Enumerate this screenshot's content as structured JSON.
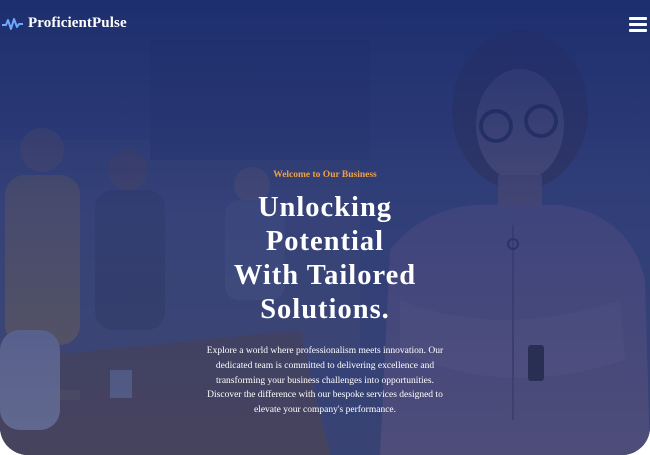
{
  "brand": {
    "name": "ProficientPulse",
    "icon": "pulse-icon"
  },
  "nav": {
    "menu_icon": "hamburger-menu-icon"
  },
  "hero": {
    "eyebrow": "Welcome to Our Business",
    "headline_lines": [
      "Unlocking",
      "Potential",
      "With Tailored",
      "Solutions."
    ],
    "description": "Explore a world where professionalism meets innovation. Our dedicated team is committed to delivering excellence and transforming your business challenges into opportunities. Discover the difference with our bespoke services designed to elevate your company's performance."
  },
  "colors": {
    "overlay": "#1c2d6e",
    "accent": "#f0a040",
    "text": "#ffffff",
    "logo_icon": "#6fa8ff"
  }
}
